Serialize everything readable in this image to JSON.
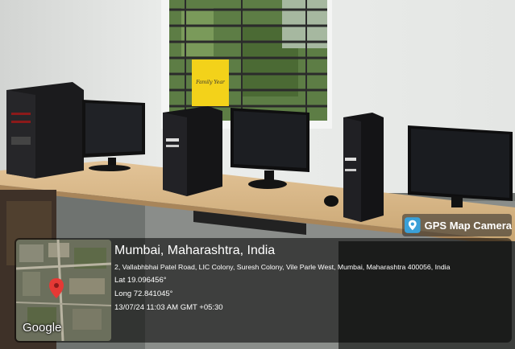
{
  "sign": {
    "text": "Family Year"
  },
  "badge": {
    "label": "GPS Map Camera",
    "icon": "map-pin-camera-icon"
  },
  "overlay": {
    "map_label": "Google",
    "city": "Mumbai, Maharashtra, India",
    "address": "2, Vallabhbhai Patel Road, LIC Colony, Suresh Colony, Vile Parle West, Mumbai, Maharashtra 400056, India",
    "lat": "Lat 19.096456°",
    "long": "Long 72.841045°",
    "datetime": "13/07/24 11:03 AM GMT +05:30"
  },
  "colors": {
    "wall": "#e8eae8",
    "desk": "#d9b98a",
    "badge_accent": "#3aa0d8"
  }
}
